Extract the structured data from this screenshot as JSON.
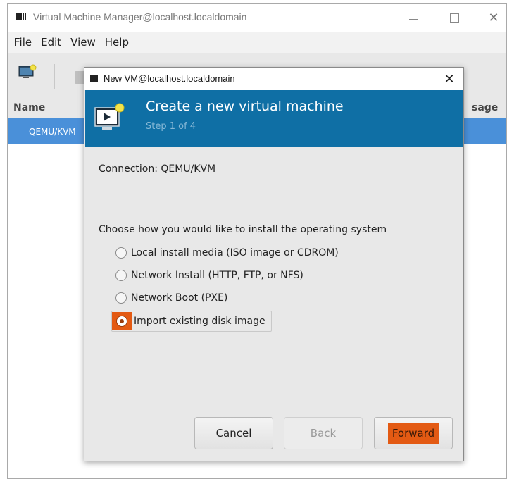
{
  "main_window": {
    "title": "Virtual Machine Manager@localhost.localdomain",
    "menu": [
      "File",
      "Edit",
      "View",
      "Help"
    ],
    "list_headers": {
      "name": "Name",
      "usage": "sage"
    },
    "rows": [
      {
        "name": "QEMU/KVM"
      }
    ]
  },
  "dialog": {
    "title": "New VM@localhost.localdomain",
    "close_glyph": "✕",
    "banner": {
      "title": "Create a new virtual machine",
      "step": "Step 1 of 4"
    },
    "connection": "Connection: QEMU/KVM",
    "prompt": "Choose how you would like to install the operating system",
    "options": [
      {
        "label": "Local install media (ISO image or CDROM)",
        "selected": false
      },
      {
        "label": "Network Install (HTTP, FTP, or NFS)",
        "selected": false
      },
      {
        "label": "Network Boot (PXE)",
        "selected": false
      },
      {
        "label": "Import existing disk image",
        "selected": true
      }
    ],
    "buttons": {
      "cancel": "Cancel",
      "back": "Back",
      "forward": "Forward"
    }
  },
  "colors": {
    "banner": "#0f6fa5",
    "selection": "#4a90d9",
    "highlight": "#e35a13"
  },
  "icons": {
    "app": "virt-manager-icon",
    "new_vm": "new-vm-monitor-icon",
    "window_controls": [
      "minimize-icon",
      "maximize-icon",
      "close-icon"
    ]
  }
}
